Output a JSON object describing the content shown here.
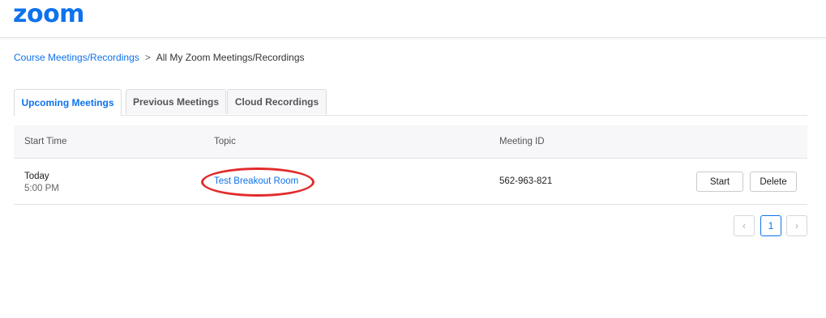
{
  "brand": {
    "logo_text": "zoom",
    "color": "#0e72ed"
  },
  "breadcrumb": {
    "link": "Course Meetings/Recordings",
    "separator": ">",
    "current": "All My Zoom Meetings/Recordings"
  },
  "tabs": [
    {
      "label": "Upcoming Meetings",
      "active": true
    },
    {
      "label": "Previous Meetings",
      "active": false
    },
    {
      "label": "Cloud Recordings",
      "active": false
    }
  ],
  "table": {
    "headers": {
      "start_time": "Start Time",
      "topic": "Topic",
      "meeting_id": "Meeting ID"
    },
    "rows": [
      {
        "day": "Today",
        "time": "5:00 PM",
        "topic": "Test Breakout Room",
        "meeting_id": "562-963-821",
        "start_label": "Start",
        "delete_label": "Delete"
      }
    ]
  },
  "pagination": {
    "prev_icon": "‹",
    "current_page": "1",
    "next_icon": "›"
  },
  "colors": {
    "accent": "#0e72ed",
    "annotation": "#e32b2b"
  }
}
